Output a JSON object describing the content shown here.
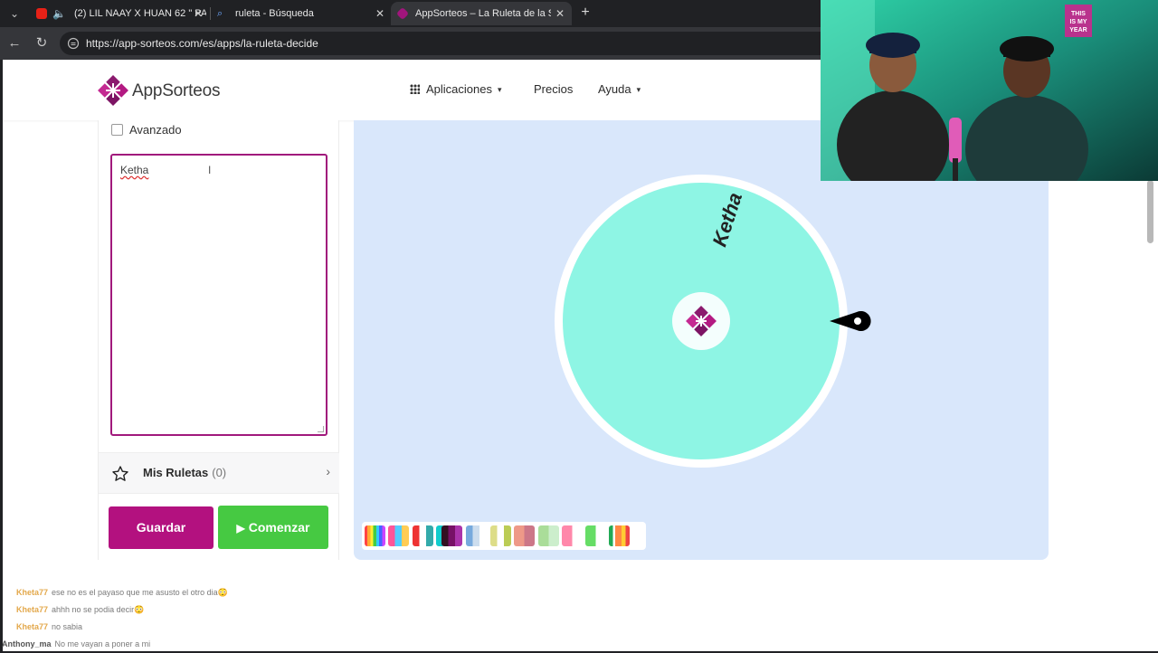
{
  "browser": {
    "tabs": [
      {
        "title": "(2) LIL NAAY X HUAN 62 \" PA",
        "active": false
      },
      {
        "title": "ruleta - Búsqueda",
        "active": false
      },
      {
        "title": "AppSorteos – La Ruleta de la Sue",
        "active": true
      }
    ],
    "new_tab": "+",
    "url": "https://app-sorteos.com/es/apps/la-ruleta-decide"
  },
  "header": {
    "logo_text": "AppSorteos",
    "nav": {
      "aplicaciones": "Aplicaciones",
      "precios": "Precios",
      "ayuda": "Ayuda"
    }
  },
  "left": {
    "advanced_label": "Avanzado",
    "names_value": "Ketha",
    "mis_ruletas_label": "Mis Ruletas",
    "mis_ruletas_count": "(0)",
    "save_label": "Guardar",
    "start_label": "Comenzar"
  },
  "wheel": {
    "entries": [
      "Ketha"
    ],
    "color": "#8ef5e4"
  },
  "chat": [
    {
      "user": "Kheta77",
      "msg": "ese no es el payaso que me asusto el otro dia😳"
    },
    {
      "user": "Kheta77",
      "msg": "ahhh no se podia decir😳"
    },
    {
      "user": "Kheta77",
      "msg": "no sabia"
    },
    {
      "user": "Anthony_ma",
      "msg": "No me vayan a poner a mi"
    }
  ],
  "colors": {
    "brand": "#b3117f",
    "start": "#46c942",
    "wheel_bg": "#d9e7fb"
  }
}
